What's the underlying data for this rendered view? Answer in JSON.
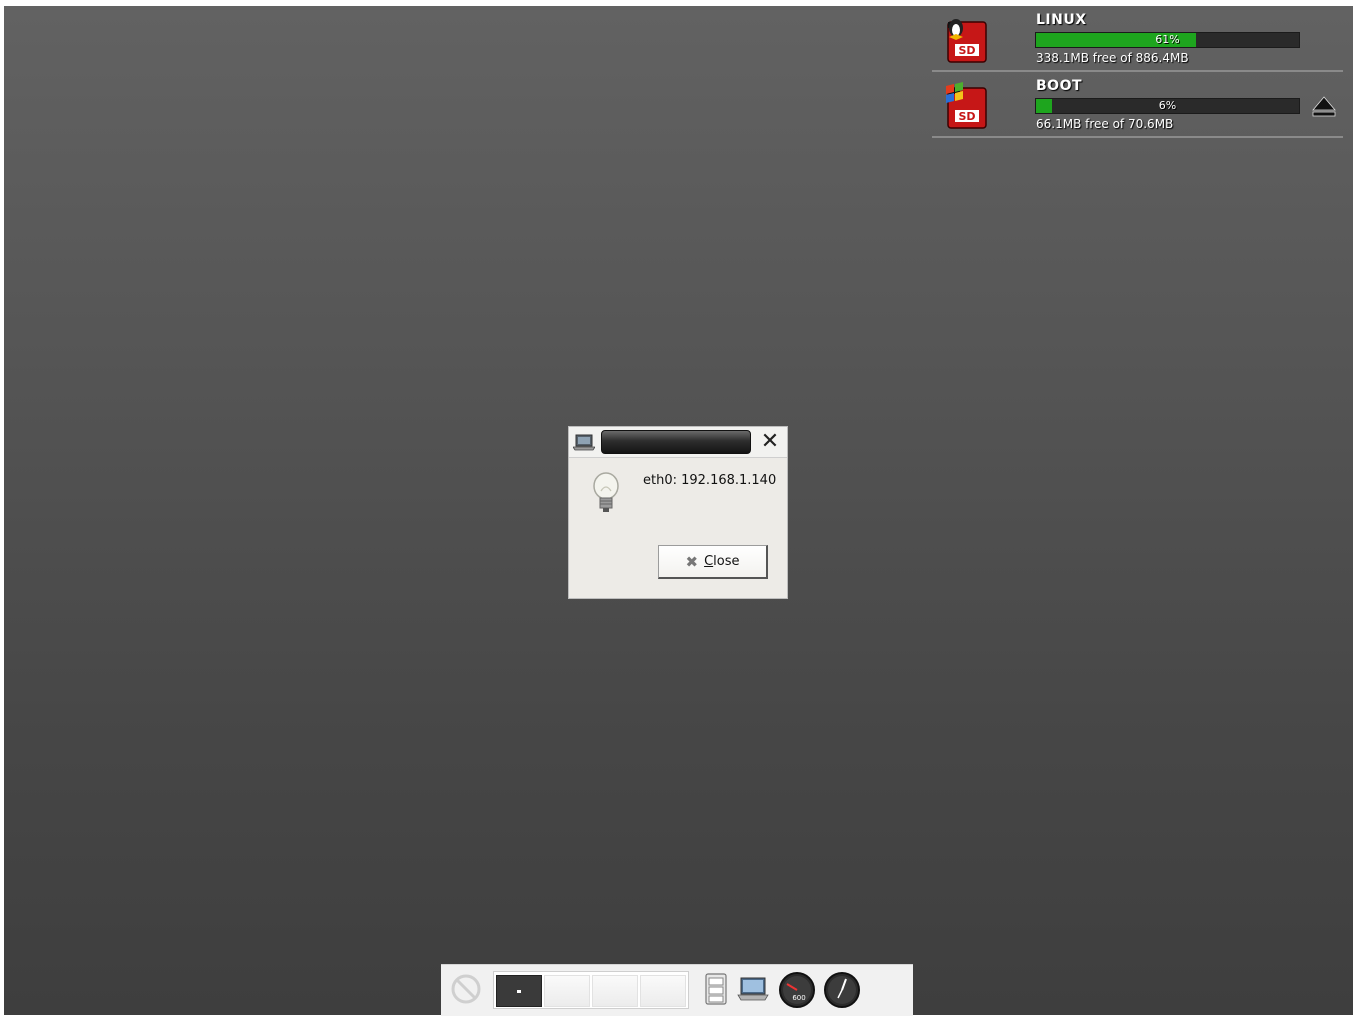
{
  "drives": [
    {
      "name": "LINUX",
      "usage_percent": 61,
      "usage_label": "61%",
      "free_text": "338.1MB free of 886.4MB",
      "icon": "sd-card-linux-icon"
    },
    {
      "name": "BOOT",
      "usage_percent": 6,
      "usage_label": "6%",
      "free_text": "66.1MB free of 70.6MB",
      "icon": "sd-card-windows-icon"
    }
  ],
  "dialog": {
    "message": "eth0: 192.168.1.140",
    "close_label": "Close",
    "close_mnemonic": "C",
    "close_rest": "lose"
  },
  "taskbar": {
    "desktops": 4,
    "active_desktop": 1,
    "gauge_label": "600"
  },
  "colors": {
    "usage_fill": "#1ea51e",
    "desktop_top": "#626262",
    "desktop_bottom": "#3e3e3e"
  }
}
